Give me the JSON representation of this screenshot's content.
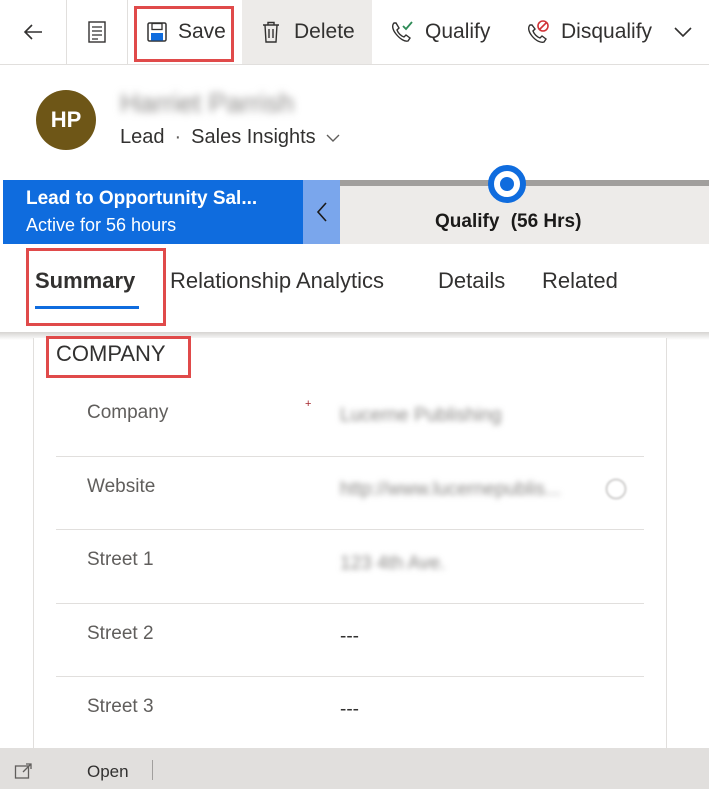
{
  "commandbar": {
    "back_icon": "back-arrow-icon",
    "form_icon": "form-icon",
    "save_label": "Save",
    "delete_label": "Delete",
    "qualify_label": "Qualify",
    "disqualify_label": "Disqualify"
  },
  "header": {
    "avatar_initials": "HP",
    "record_name": "Harriet Parrish",
    "entity": "Lead",
    "separator": "·",
    "form_selector": "Sales Insights"
  },
  "bpf": {
    "process_name": "Lead to Opportunity Sal...",
    "active_text": "Active for 56 hours",
    "active_stage": "Qualify",
    "stage_duration": "(56 Hrs)"
  },
  "tabs": [
    {
      "label": "Summary",
      "selected": true
    },
    {
      "label": "Relationship Analytics",
      "selected": false
    },
    {
      "label": "Details",
      "selected": false
    },
    {
      "label": "Related",
      "selected": false
    }
  ],
  "section": {
    "title": "COMPANY",
    "fields": [
      {
        "label": "Company",
        "value": "Lucerne Publishing",
        "required": "+"
      },
      {
        "label": "Website",
        "value": "http://www.lucernepublis..."
      },
      {
        "label": "Street 1",
        "value": "123 4th Ave."
      },
      {
        "label": "Street 2",
        "value": "---"
      },
      {
        "label": "Street 3",
        "value": "---"
      }
    ]
  },
  "footer": {
    "open_label": "Open"
  },
  "colors": {
    "accent": "#0f6cde",
    "avatar": "#6e5617",
    "highlight": "#e04a4a"
  }
}
